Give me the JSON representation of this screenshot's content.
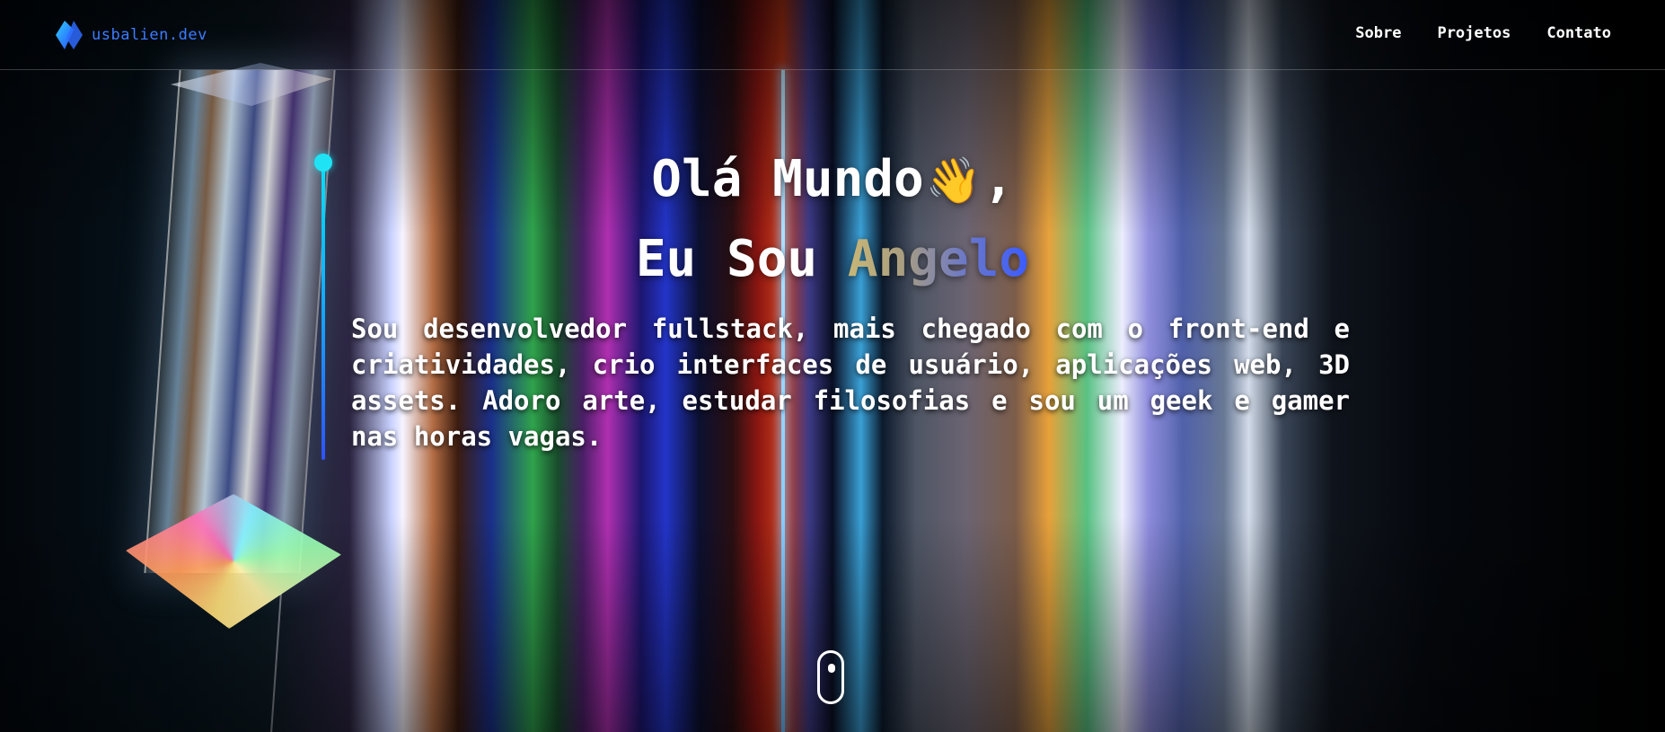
{
  "navbar": {
    "logo_text": "usbalien.dev",
    "links": [
      {
        "label": "Sobre"
      },
      {
        "label": "Projetos"
      },
      {
        "label": "Contato"
      }
    ]
  },
  "hero": {
    "greeting": "Olá Mundo",
    "wave_emoji": "👋",
    "greeting_suffix": ",",
    "intro_prefix": "Eu Sou",
    "name": "Angelo",
    "description": "Sou desenvolvedor fullstack, mais chegado com o front-end e criatividades, crio interfaces de usuário, aplicações web, 3D assets. Adoro arte, estudar filosofias e sou um geek e gamer nas horas vagas."
  },
  "icons": {
    "logo": "diamond-logo-icon",
    "wave": "waving-hand-icon",
    "scroll": "mouse-scroll-icon"
  },
  "colors": {
    "accent": "#3d7bff",
    "progress_top": "#00e1ff",
    "progress_bottom": "#2e52ff",
    "name_gradient_start": "#c9b777",
    "name_gradient_end": "#3a5bff"
  }
}
